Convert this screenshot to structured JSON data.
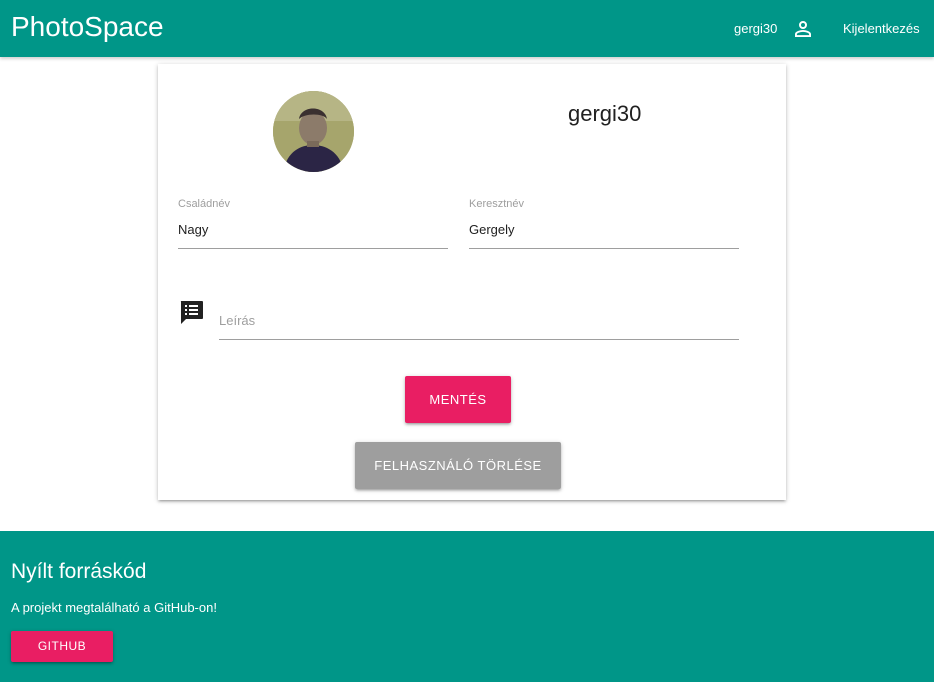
{
  "navbar": {
    "brand": "PhotoSpace",
    "username": "gergi30",
    "logout_label": "Kijelentkezés",
    "background": "#009688"
  },
  "profile": {
    "name": "gergi30",
    "avatar_icon": "user-avatar-photo",
    "last_name": {
      "label": "Családnév",
      "value": "Nagy"
    },
    "first_name": {
      "label": "Keresztnév",
      "value": "Gergely"
    },
    "description": {
      "placeholder": "Leírás",
      "value": "",
      "icon": "description-list-icon"
    },
    "save_label": "MENTÉS",
    "delete_label": "FELHASZNÁLÓ TÖRLÉSE"
  },
  "footer": {
    "title": "Nyílt forráskód",
    "text": "A projekt megtalálható a GitHub-on!",
    "github_label": "GITHUB"
  },
  "colors": {
    "primary": "#009688",
    "accent": "#e91e63",
    "secondary_button": "#9e9e9e"
  }
}
